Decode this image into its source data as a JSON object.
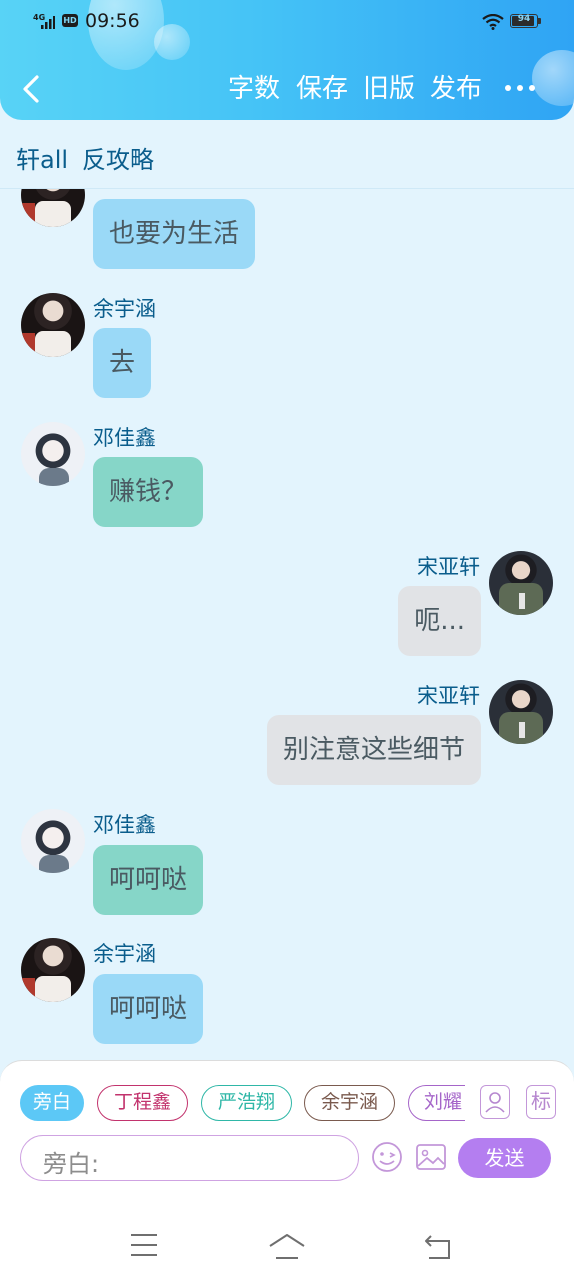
{
  "status": {
    "time": "09:56",
    "network": "4G",
    "hd": "HD",
    "battery": "94",
    "battery_level": 0.94
  },
  "header": {
    "buttons": [
      "字数",
      "保存",
      "旧版",
      "发布"
    ]
  },
  "title": {
    "story": "轩all",
    "chapter": "反攻略"
  },
  "messages": [
    {
      "speaker": "",
      "text": "也要为生活",
      "side": "left",
      "color": "blue"
    },
    {
      "speaker": "余宇涵",
      "text": "去",
      "side": "left",
      "color": "blue"
    },
    {
      "speaker": "邓佳鑫",
      "text": "赚钱？",
      "side": "left",
      "color": "green"
    },
    {
      "speaker": "宋亚轩",
      "text": "呃...",
      "side": "right",
      "color": "grey"
    },
    {
      "speaker": "宋亚轩",
      "text": "别注意这些细节",
      "side": "right",
      "color": "grey"
    },
    {
      "speaker": "邓佳鑫",
      "text": "呵呵哒",
      "side": "left",
      "color": "green"
    },
    {
      "speaker": "余宇涵",
      "text": "呵呵哒",
      "side": "left",
      "color": "blue"
    }
  ],
  "characters": [
    {
      "label": "旁白",
      "color": "#5cc8f6",
      "active": true
    },
    {
      "label": "丁程鑫",
      "color": "#c2336d",
      "active": false
    },
    {
      "label": "严浩翔",
      "color": "#2fb7a7",
      "active": false
    },
    {
      "label": "余宇涵",
      "color": "#7a5a4e",
      "active": false
    },
    {
      "label": "刘耀",
      "color": "#a565c9",
      "active": false
    }
  ],
  "tools": {
    "character_icon": "person-icon",
    "mark_label": "标"
  },
  "input": {
    "placeholder": "旁白:",
    "send_label": "发送"
  },
  "colors": {
    "header": "#45c3f6",
    "background": "#e3f4fd",
    "send": "#b47ef0",
    "bubble_blue": "#9ad9f7",
    "bubble_green": "#86d6c8",
    "bubble_grey": "#e1e3e6",
    "name_text": "#0a5d8c"
  }
}
